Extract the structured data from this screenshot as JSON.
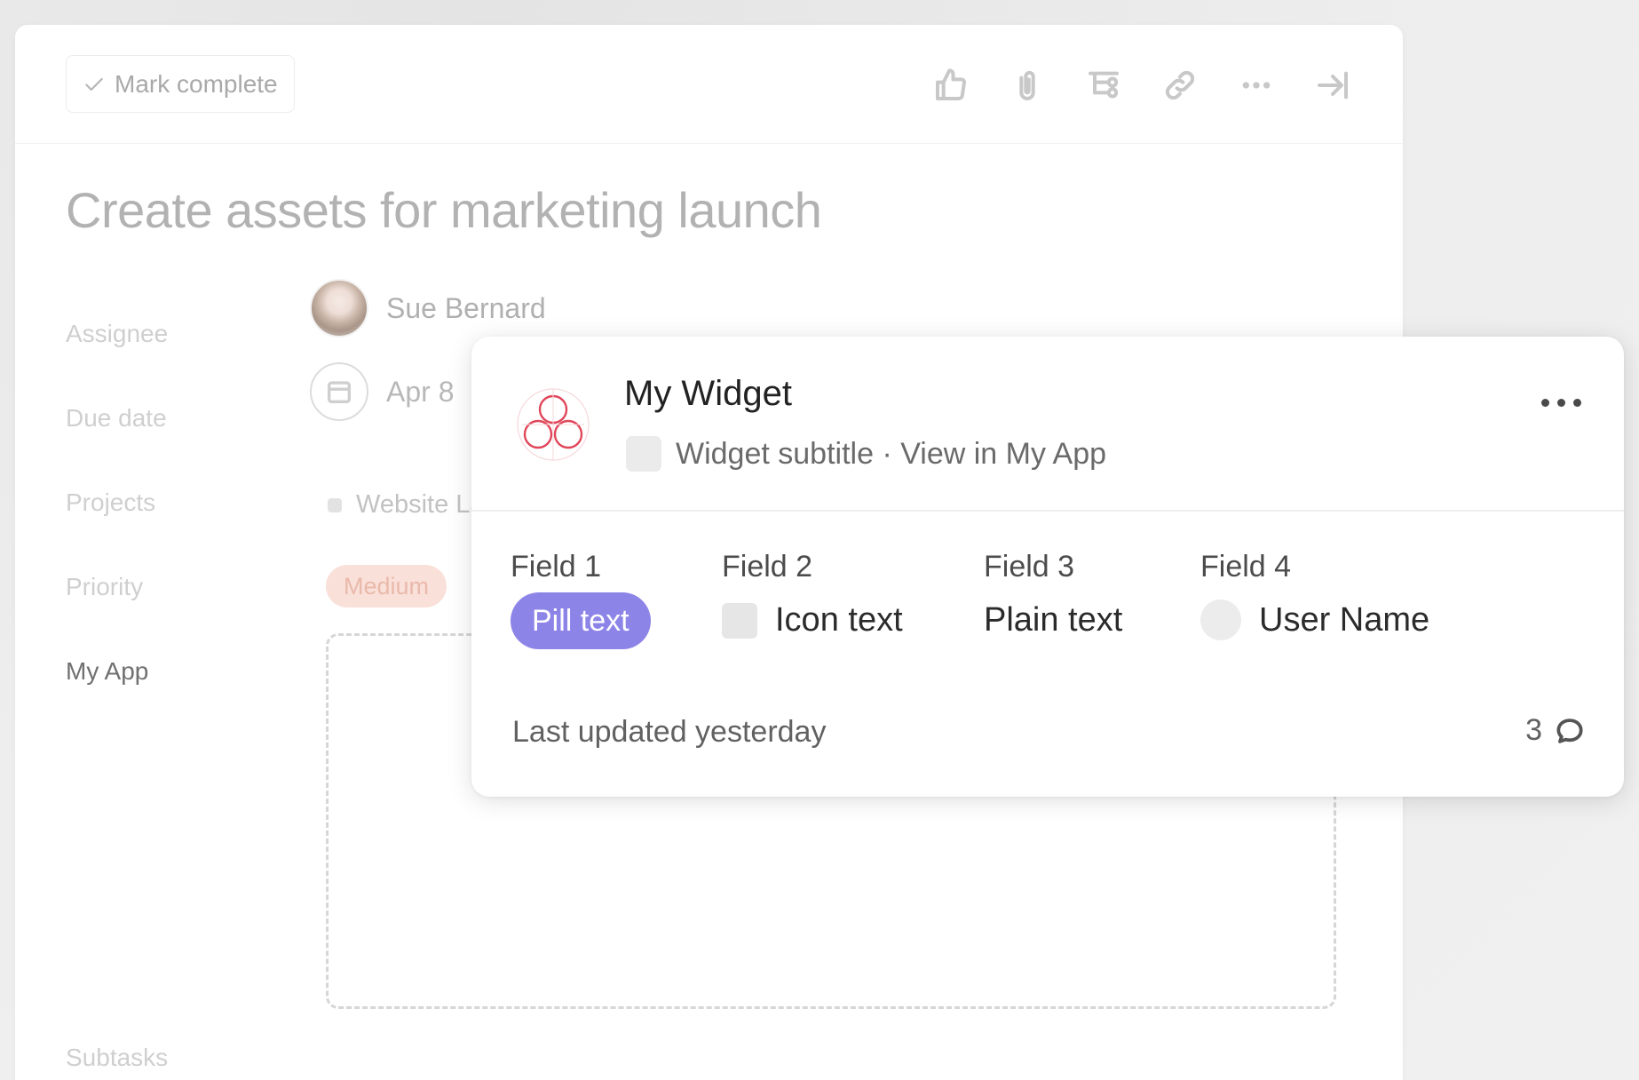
{
  "task": {
    "mark_complete_label": "Mark complete",
    "title": "Create assets for marketing launch",
    "toolbar_icons": [
      "thumbs-up-icon",
      "paperclip-icon",
      "subtask-icon",
      "link-icon",
      "more-icon",
      "close-panel-icon"
    ],
    "fields": {
      "assignee_label": "Assignee",
      "assignee_name": "Sue Bernard",
      "due_label": "Due date",
      "due_value": "Apr 8",
      "projects_label": "Projects",
      "project_name": "Website La",
      "priority_label": "Priority",
      "priority_value": "Medium",
      "app_label": "My App",
      "subtasks_label": "Subtasks"
    }
  },
  "widget": {
    "title": "My Widget",
    "subtitle": "Widget subtitle · View in My App",
    "columns": [
      {
        "label": "Field 1",
        "value": "Pill text",
        "kind": "pill",
        "pill_color": "#8d84e8"
      },
      {
        "label": "Field 2",
        "value": "Icon text",
        "kind": "icon"
      },
      {
        "label": "Field 3",
        "value": "Plain text",
        "kind": "plain"
      },
      {
        "label": "Field 4",
        "value": "User Name",
        "kind": "user"
      }
    ],
    "footer": {
      "updated": "Last updated yesterday",
      "comment_count": "3"
    }
  },
  "colors": {
    "accent_pill": "#8d84e8",
    "priority_pill_bg": "#f9e0d9",
    "logo_red": "#e0475a"
  }
}
